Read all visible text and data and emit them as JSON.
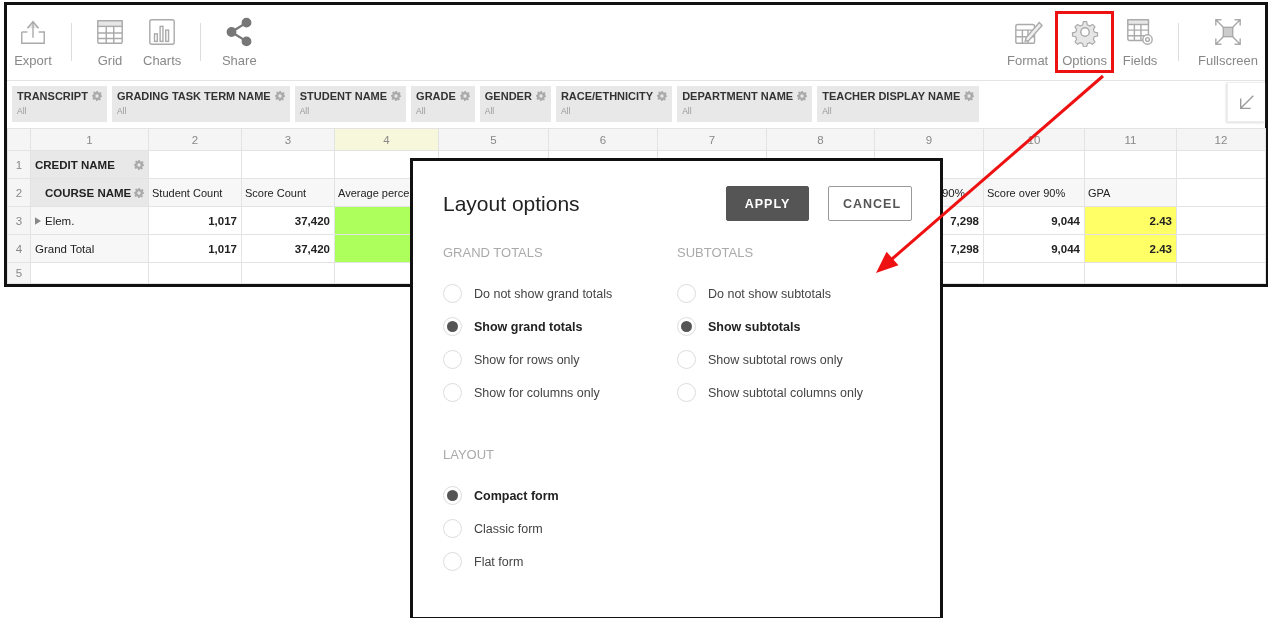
{
  "toolbar": {
    "left_groups": [
      [
        {
          "label": "Export",
          "highlighted": false
        }
      ],
      [
        {
          "label": "Grid",
          "highlighted": false
        },
        {
          "label": "Charts",
          "highlighted": false
        }
      ],
      [
        {
          "label": "Share",
          "highlighted": false
        }
      ]
    ],
    "right_groups": [
      [
        {
          "label": "Format",
          "highlighted": false
        },
        {
          "label": "Options",
          "highlighted": true
        },
        {
          "label": "Fields",
          "highlighted": false
        }
      ],
      [
        {
          "label": "Fullscreen",
          "highlighted": false
        }
      ]
    ]
  },
  "filters": [
    {
      "label": "TRANSCRIPT",
      "value": "All"
    },
    {
      "label": "GRADING TASK TERM NAME",
      "value": "All"
    },
    {
      "label": "STUDENT NAME",
      "value": "All"
    },
    {
      "label": "GRADE",
      "value": "All"
    },
    {
      "label": "GENDER",
      "value": "All"
    },
    {
      "label": "RACE/ETHNICITY",
      "value": "All"
    },
    {
      "label": "DEPARTMENT NAME",
      "value": "All"
    },
    {
      "label": "TEACHER DISPLAY NAME",
      "value": "All"
    }
  ],
  "grid": {
    "columns": [
      {
        "label": "1",
        "selected": false
      },
      {
        "label": "2",
        "selected": false
      },
      {
        "label": "3",
        "selected": false
      },
      {
        "label": "4",
        "selected": true
      },
      {
        "label": "5",
        "selected": false
      },
      {
        "label": "6",
        "selected": false
      },
      {
        "label": "7",
        "selected": false
      },
      {
        "label": "8",
        "selected": false
      },
      {
        "label": "9",
        "selected": false
      },
      {
        "label": "10",
        "selected": false
      },
      {
        "label": "11",
        "selected": false
      },
      {
        "label": "12",
        "selected": false
      }
    ],
    "rows": [
      {
        "number": "1",
        "cells": [
          {
            "kind": "field",
            "text": "CREDIT NAME"
          },
          {
            "kind": "blank"
          },
          {
            "kind": "blank"
          },
          {
            "kind": "blank"
          },
          {
            "kind": "blank"
          },
          {
            "kind": "blank"
          },
          {
            "kind": "blank"
          },
          {
            "kind": "blank"
          },
          {
            "kind": "blank"
          },
          {
            "kind": "blank"
          },
          {
            "kind": "blank"
          },
          {
            "kind": "blank"
          }
        ]
      },
      {
        "number": "2",
        "cells": [
          {
            "kind": "field_indent",
            "text": "COURSE NAME"
          },
          {
            "kind": "header",
            "text": "Student Count"
          },
          {
            "kind": "header",
            "text": "Score Count"
          },
          {
            "kind": "header",
            "text": "Average perce"
          },
          {
            "kind": "blank"
          },
          {
            "kind": "blank"
          },
          {
            "kind": "blank"
          },
          {
            "kind": "blank"
          },
          {
            "kind": "header_partial",
            "text": "90%"
          },
          {
            "kind": "header",
            "text": "Score over 90%"
          },
          {
            "kind": "header",
            "text": "GPA"
          },
          {
            "kind": "blank"
          }
        ]
      },
      {
        "number": "3",
        "cells": [
          {
            "kind": "row_label",
            "text": "Elem.",
            "expandable": true
          },
          {
            "kind": "num",
            "text": "1,017"
          },
          {
            "kind": "num",
            "text": "37,420"
          },
          {
            "kind": "fill",
            "color": "#adff5c"
          },
          {
            "kind": "blank"
          },
          {
            "kind": "blank"
          },
          {
            "kind": "blank"
          },
          {
            "kind": "blank"
          },
          {
            "kind": "num",
            "text": "7,298"
          },
          {
            "kind": "num",
            "text": "9,044"
          },
          {
            "kind": "num",
            "text": "2.43",
            "color": "#ffff66"
          },
          {
            "kind": "blank"
          }
        ]
      },
      {
        "number": "4",
        "cells": [
          {
            "kind": "row_label",
            "text": "Grand Total",
            "expandable": false
          },
          {
            "kind": "num",
            "text": "1,017"
          },
          {
            "kind": "num",
            "text": "37,420"
          },
          {
            "kind": "fill",
            "color": "#adff5c"
          },
          {
            "kind": "blank"
          },
          {
            "kind": "blank"
          },
          {
            "kind": "blank"
          },
          {
            "kind": "blank"
          },
          {
            "kind": "num",
            "text": "7,298"
          },
          {
            "kind": "num",
            "text": "9,044"
          },
          {
            "kind": "num",
            "text": "2.43",
            "color": "#ffff66"
          },
          {
            "kind": "blank"
          }
        ]
      },
      {
        "number": "5",
        "cells": [
          {
            "kind": "blank"
          },
          {
            "kind": "blank"
          },
          {
            "kind": "blank"
          },
          {
            "kind": "blank"
          },
          {
            "kind": "blank"
          },
          {
            "kind": "blank"
          },
          {
            "kind": "blank"
          },
          {
            "kind": "blank"
          },
          {
            "kind": "blank"
          },
          {
            "kind": "blank"
          },
          {
            "kind": "blank"
          },
          {
            "kind": "blank"
          }
        ]
      }
    ]
  },
  "dialog": {
    "title": "Layout options",
    "buttons": [
      {
        "label": "APPLY",
        "kind": "primary"
      },
      {
        "label": "CANCEL",
        "kind": "secondary"
      }
    ],
    "groups": [
      {
        "title": "GRAND TOTALS",
        "options": [
          {
            "label": "Do not show grand totals",
            "selected": false
          },
          {
            "label": "Show grand totals",
            "selected": true
          },
          {
            "label": "Show for rows only",
            "selected": false
          },
          {
            "label": "Show for columns only",
            "selected": false
          }
        ]
      },
      {
        "title": "SUBTOTALS",
        "options": [
          {
            "label": "Do not show subtotals",
            "selected": false
          },
          {
            "label": "Show subtotals",
            "selected": true
          },
          {
            "label": "Show subtotal rows only",
            "selected": false
          },
          {
            "label": "Show subtotal columns only",
            "selected": false
          }
        ]
      },
      {
        "title": "LAYOUT",
        "options": [
          {
            "label": "Compact form",
            "selected": true
          },
          {
            "label": "Classic form",
            "selected": false
          },
          {
            "label": "Flat form",
            "selected": false
          }
        ]
      }
    ]
  }
}
